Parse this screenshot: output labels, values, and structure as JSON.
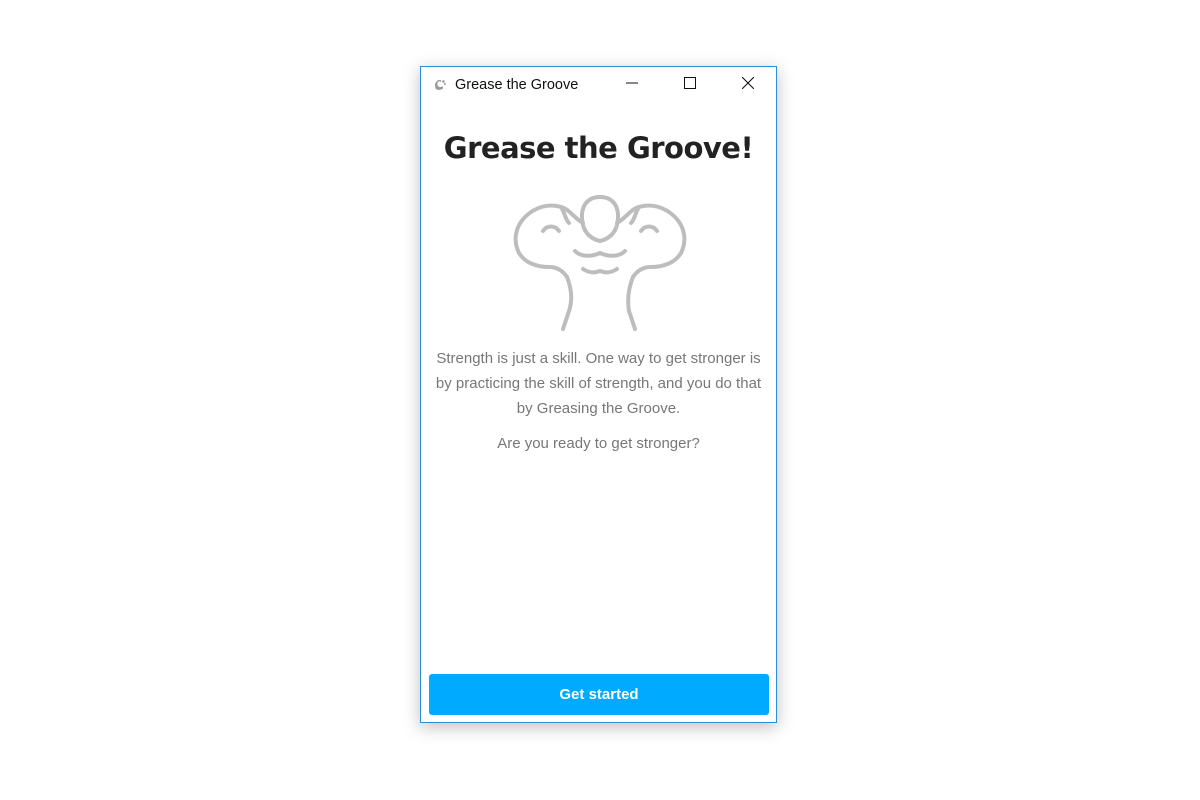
{
  "window": {
    "title": "Grease the Groove",
    "app_icon": "app-logo-icon",
    "controls": {
      "minimize": "minimize-icon",
      "maximize": "maximize-icon",
      "close": "close-icon"
    },
    "border_color": "#2b8fd8"
  },
  "main": {
    "heading": "Grease the Groove!",
    "illustration": "flexing-strongman-icon",
    "description": "Strength is just a skill. One way to get stronger is by practicing the skill of strength, and you do that by Greasing the Groove.",
    "question": "Are you ready to get stronger?",
    "cta_label": "Get started",
    "accent_color": "#00aaff"
  }
}
